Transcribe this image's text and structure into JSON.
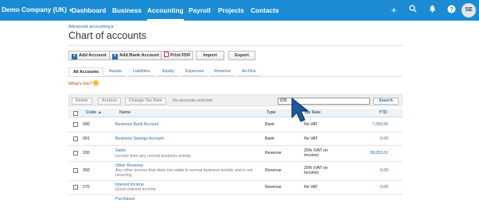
{
  "app": {
    "org_name": "Demo Company (UK)",
    "nav": [
      "Dashboard",
      "Business",
      "Accounting",
      "Payroll",
      "Projects",
      "Contacts"
    ],
    "active_nav": "Accounting",
    "avatar_initials": "SE",
    "accent_color": "#1b8bd4"
  },
  "page": {
    "breadcrumb": "Advanced accounting ▸",
    "title": "Chart of accounts",
    "actions": [
      "Add Account",
      "Add Bank Account",
      "Print PDF",
      "Import",
      "Export"
    ],
    "tabs": [
      "All Accounts",
      "Assets",
      "Liabilities",
      "Equity",
      "Expenses",
      "Revenue",
      "Archive"
    ],
    "active_tab": "All Accounts",
    "whats_this": "What's this?"
  },
  "toolbar": {
    "delete_label": "Delete",
    "archive_label": "Archive",
    "change_tax_label": "Change Tax Rate",
    "status": "No accounts selected",
    "search_value": "835",
    "search_button": "Search"
  },
  "table": {
    "headers": [
      "Code ▲",
      "Name",
      "Type",
      "Tax Rate",
      "YTD"
    ],
    "rows": [
      {
        "code": "090",
        "name": "Business Bank Account",
        "desc": "",
        "type": "Bank",
        "tax": "No VAT",
        "ytd": "7,065.50"
      },
      {
        "code": "091",
        "name": "Business Savings Account",
        "desc": "",
        "type": "Bank",
        "tax": "No VAT",
        "ytd": "0.00"
      },
      {
        "code": "200",
        "name": "Sales",
        "desc": "Income from any normal business activity",
        "type": "Revenue",
        "tax": "20% (VAT on Income)",
        "ytd": "38,053.61"
      },
      {
        "code": "260",
        "name": "Other Revenue",
        "desc": "Any other income that does not relate to normal business activity and is not recurring",
        "type": "Revenue",
        "tax": "20% (VAT on Income)",
        "ytd": "0.00"
      },
      {
        "code": "270",
        "name": "Interest Income",
        "desc": "Gross interest income",
        "type": "Revenue",
        "tax": "No VAT",
        "ytd": "0.00"
      },
      {
        "code": "",
        "name": "Purchases",
        "desc": "",
        "type": "",
        "tax": "",
        "ytd": ""
      }
    ]
  }
}
